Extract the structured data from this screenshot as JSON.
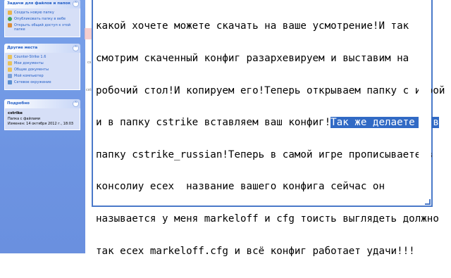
{
  "sidebar": {
    "tasks": {
      "title": "Задачи для файлов и папок",
      "items": [
        {
          "label": "Создать новую папку",
          "icon": "new-folder-icon",
          "color": "#e9b44c"
        },
        {
          "label": "Опубликовать папку в вебе",
          "icon": "publish-web-icon",
          "color": "#3fa35a"
        },
        {
          "label": "Открыть общий доступ к этой папке",
          "icon": "share-folder-icon",
          "color": "#d98c3a"
        }
      ]
    },
    "places": {
      "title": "Другие места",
      "items": [
        {
          "label": "Counter-Strike 1.6",
          "icon": "folder-icon",
          "color": "#e9c25a"
        },
        {
          "label": "Мои документы",
          "icon": "my-documents-icon",
          "color": "#e9c25a"
        },
        {
          "label": "Общие документы",
          "icon": "shared-documents-icon",
          "color": "#e9c25a"
        },
        {
          "label": "Мой компьютер",
          "icon": "my-computer-icon",
          "color": "#7aa0d8"
        },
        {
          "label": "Сетевое окружение",
          "icon": "network-icon",
          "color": "#5a8fd0"
        }
      ]
    },
    "details": {
      "title": "Подробно",
      "name": "cstrike",
      "type": "Папка с файлами",
      "modified": "Изменен: 14 октября 2012 г., 18:03"
    }
  },
  "gap_fragments": [
    "cs",
    "cstr"
  ],
  "editor": {
    "lines": [
      {
        "text": "какой хочете можете скачать на ваше усмотрение!И так"
      },
      {
        "text": "смотрим скаченный конфиг разархевируем и выставим на"
      },
      {
        "text": "робочий стол!И копируем его!Теперь открываем папку с игрой"
      },
      {
        "text": "и в папку cstrike вставляем ваш конфиг!",
        "selected": "Так же делаете и в"
      },
      {
        "text": "папку cstrike_russian!Теперь в самой игре прописываете в"
      },
      {
        "text": "консолиу есех  название вашего конфига сейчас он"
      },
      {
        "text": "называется у меня markeloff и cfg тоисть выглядеть должно"
      },
      {
        "text": "так есех markeloff.cfg и всё конфиг работает удачи!!!"
      }
    ],
    "selection_color": "#316ac5"
  }
}
